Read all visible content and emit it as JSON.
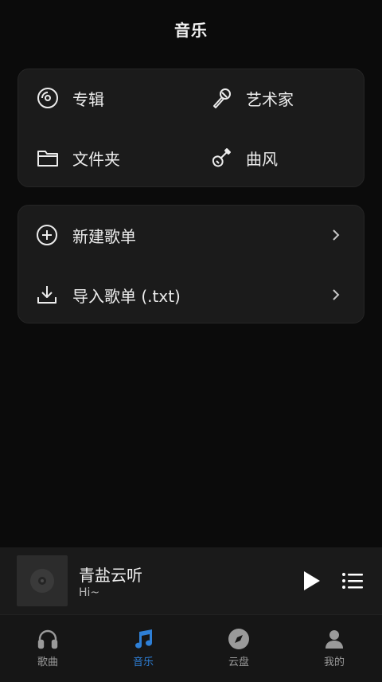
{
  "header": {
    "title": "音乐"
  },
  "library": {
    "items": [
      {
        "label": "专辑",
        "icon": "disc-icon"
      },
      {
        "label": "艺术家",
        "icon": "microphone-icon"
      },
      {
        "label": "文件夹",
        "icon": "folder-icon"
      },
      {
        "label": "曲风",
        "icon": "guitar-icon"
      }
    ]
  },
  "playlist_actions": {
    "items": [
      {
        "label": "新建歌单",
        "icon": "plus-circle-icon"
      },
      {
        "label": "导入歌单 (.txt)",
        "icon": "download-icon"
      }
    ]
  },
  "player": {
    "title": "青盐云听",
    "subtitle": "Hi~"
  },
  "tabbar": {
    "tabs": [
      {
        "label": "歌曲",
        "icon": "headphones-icon",
        "active": false
      },
      {
        "label": "音乐",
        "icon": "music-note-icon",
        "active": true
      },
      {
        "label": "云盘",
        "icon": "compass-icon",
        "active": false
      },
      {
        "label": "我的",
        "icon": "user-icon",
        "active": false
      }
    ]
  },
  "colors": {
    "background": "#0b0b0b",
    "card": "#1b1b1b",
    "accent": "#2e7fd6"
  }
}
